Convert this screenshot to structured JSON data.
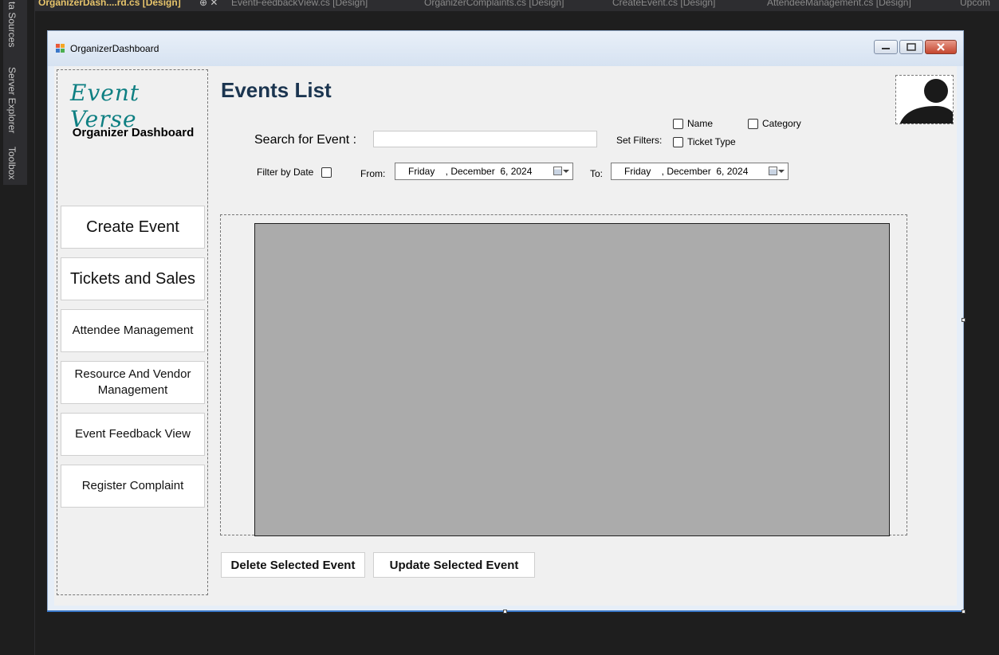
{
  "ide": {
    "side_tabs": [
      "ta Sources",
      "Server Explorer",
      "Toolbox"
    ],
    "doc_tabs": [
      {
        "label": "OrganizerDash....rd.cs [Design]",
        "active": true
      },
      {
        "label": "EventFeedbackView.cs [Design]"
      },
      {
        "label": "OrganizerComplaints.cs [Design]"
      },
      {
        "label": "CreateEvent.cs [Design]"
      },
      {
        "label": "AttendeeManagement.cs [Design]"
      },
      {
        "label": "Upcom"
      }
    ]
  },
  "window": {
    "title": "OrganizerDashboard"
  },
  "sidebar": {
    "logo": "Event Verse",
    "subtitle": "Organizer Dashboard",
    "items": [
      {
        "label": "Create Event"
      },
      {
        "label": "Tickets and Sales"
      },
      {
        "label": "Attendee Management"
      },
      {
        "label": "Resource And Vendor Management"
      },
      {
        "label": "Event Feedback View"
      },
      {
        "label": "Register Complaint"
      }
    ]
  },
  "main": {
    "title": "Events List",
    "search_label": "Search for Event :",
    "search_value": "",
    "set_filters_label": "Set Filters:",
    "filters": [
      {
        "label": "Name",
        "checked": false
      },
      {
        "label": "Category",
        "checked": false
      },
      {
        "label": "Ticket Type",
        "checked": false
      }
    ],
    "filter_by_date_label": "Filter by Date",
    "filter_by_date_checked": false,
    "from_label": "From:",
    "from_date": "Friday    , December  6, 2024",
    "to_label": "To:",
    "to_date": "Friday    , December  6, 2024",
    "delete_button": "Delete Selected Event",
    "update_button": "Update Selected Event"
  },
  "colors": {
    "accent": "#0e7f82",
    "title": "#1b3550",
    "grid_bg": "#ababab"
  }
}
